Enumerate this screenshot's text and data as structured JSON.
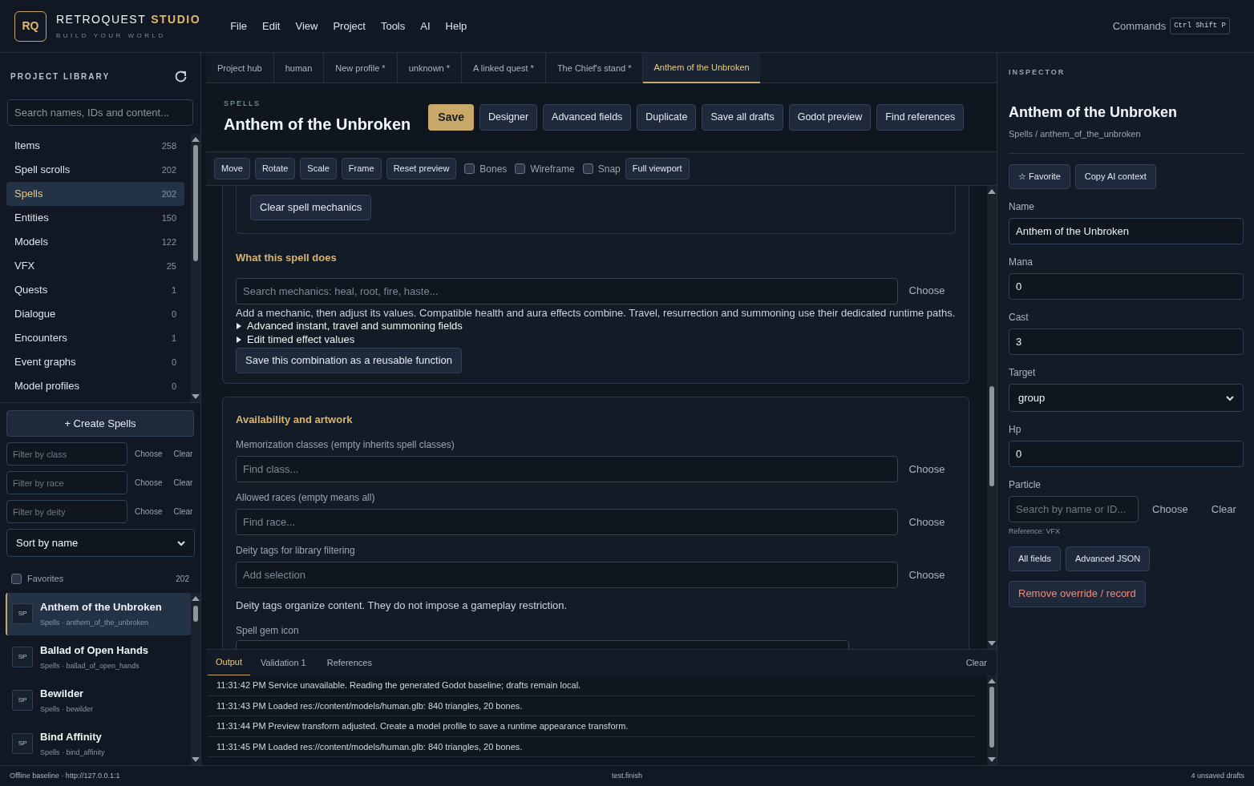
{
  "brand": {
    "logo": "RQ",
    "name": "RETROQUEST",
    "accent": "STUDIO",
    "tagline": "BUILD YOUR WORLD"
  },
  "menu": [
    "File",
    "Edit",
    "View",
    "Project",
    "Tools",
    "AI",
    "Help"
  ],
  "commands": {
    "label": "Commands",
    "shortcut": "Ctrl Shift P"
  },
  "library": {
    "title": "PROJECT LIBRARY",
    "search": {
      "placeholder": "Search names, IDs and content..."
    },
    "categories": [
      {
        "label": "Items",
        "count": "258",
        "selected": false
      },
      {
        "label": "Spell scrolls",
        "count": "202",
        "selected": false
      },
      {
        "label": "Spells",
        "count": "202",
        "selected": true
      },
      {
        "label": "Entities",
        "count": "150",
        "selected": false
      },
      {
        "label": "Models",
        "count": "122",
        "selected": false
      },
      {
        "label": "VFX",
        "count": "25",
        "selected": false
      },
      {
        "label": "Quests",
        "count": "1",
        "selected": false
      },
      {
        "label": "Dialogue",
        "count": "0",
        "selected": false
      },
      {
        "label": "Encounters",
        "count": "1",
        "selected": false
      },
      {
        "label": "Event graphs",
        "count": "0",
        "selected": false
      },
      {
        "label": "Model profiles",
        "count": "0",
        "selected": false
      }
    ],
    "create_button": "+ Create Spells",
    "filters": [
      {
        "placeholder": "Filter by class",
        "choose": "Choose",
        "clear": "Clear"
      },
      {
        "placeholder": "Filter by race",
        "choose": "Choose",
        "clear": "Clear"
      },
      {
        "placeholder": "Filter by deity",
        "choose": "Choose",
        "clear": "Clear"
      }
    ],
    "sort": "Sort by name",
    "favorites": {
      "label": "Favorites",
      "checked": false,
      "count": "202"
    },
    "records": [
      {
        "badge": "SP",
        "name": "Anthem of the Unbroken",
        "path": "Spells · anthem_of_the_unbroken",
        "selected": true
      },
      {
        "badge": "SP",
        "name": "Ballad of Open Hands",
        "path": "Spells · ballad_of_open_hands",
        "selected": false
      },
      {
        "badge": "SP",
        "name": "Bewilder",
        "path": "Spells · bewilder",
        "selected": false
      },
      {
        "badge": "SP",
        "name": "Bind Affinity",
        "path": "Spells · bind_affinity",
        "selected": false
      }
    ]
  },
  "tabs": [
    {
      "label": "Project hub",
      "selected": false
    },
    {
      "label": "human",
      "selected": false
    },
    {
      "label": "New profile *",
      "selected": false
    },
    {
      "label": "unknown *",
      "selected": false
    },
    {
      "label": "A linked quest *",
      "selected": false
    },
    {
      "label": "The Chief's stand *",
      "selected": false
    },
    {
      "label": "Anthem of the Unbroken",
      "selected": true
    }
  ],
  "editor": {
    "category": "SPELLS",
    "title": "Anthem of the Unbroken",
    "actions": [
      {
        "label": "Save",
        "kind": "primary"
      },
      {
        "label": "Designer",
        "kind": "default"
      },
      {
        "label": "Advanced fields",
        "kind": "default"
      },
      {
        "label": "Duplicate",
        "kind": "default"
      },
      {
        "label": "Save all drafts",
        "kind": "default"
      },
      {
        "label": "Godot preview",
        "kind": "default"
      },
      {
        "label": "Find references",
        "kind": "default"
      }
    ],
    "toolbar": [
      {
        "kind": "button",
        "label": "Move"
      },
      {
        "kind": "button",
        "label": "Rotate"
      },
      {
        "kind": "button",
        "label": "Scale"
      },
      {
        "kind": "button",
        "label": "Frame"
      },
      {
        "kind": "button",
        "label": "Reset preview"
      },
      {
        "kind": "checkbox",
        "label": "Bones",
        "checked": false
      },
      {
        "kind": "checkbox",
        "label": "Wireframe",
        "checked": false
      },
      {
        "kind": "checkbox",
        "label": "Snap",
        "checked": false
      },
      {
        "kind": "button",
        "label": "Full viewport"
      }
    ],
    "mechanics": {
      "clear_button": "Clear spell mechanics",
      "heading": "What this spell does",
      "search": {
        "placeholder": "Search mechanics: heal, root, fire, haste...",
        "choose": "Choose"
      },
      "help": "Add a mechanic, then adjust its values. Compatible health and aura effects combine. Travel, resurrection and summoning use their dedicated runtime paths.",
      "disclosures": [
        {
          "label": "Advanced instant, travel and summoning fields",
          "expanded": false
        },
        {
          "label": "Edit timed effect values",
          "expanded": false
        }
      ],
      "save_button": "Save this combination as a reusable function"
    },
    "availability": {
      "heading": "Availability and artwork",
      "fields": [
        {
          "label": "Memorization classes (empty inherits spell classes)",
          "placeholder": "Find class...",
          "choose": "Choose"
        },
        {
          "label": "Allowed races (empty means all)",
          "placeholder": "Find race...",
          "choose": "Choose"
        },
        {
          "label": "Deity tags for library filtering",
          "placeholder": "Add selection",
          "choose": "Choose"
        }
      ],
      "note": "Deity tags organize content. They do not impose a gameplay restriction.",
      "icon_label": "Spell gem icon"
    }
  },
  "output": {
    "tabs": [
      {
        "label": "Output",
        "selected": true
      },
      {
        "label": "Validation 1",
        "selected": false
      },
      {
        "label": "References",
        "selected": false
      }
    ],
    "clear": "Clear",
    "lines": [
      "11:31:42 PM Service unavailable. Reading the generated Godot baseline; drafts remain local.",
      "11:31:43 PM Loaded res://content/models/human.glb: 840 triangles, 20 bones.",
      "11:31:44 PM Preview transform adjusted. Create a model profile to save a runtime appearance transform.",
      "11:31:45 PM Loaded res://content/models/human.glb: 840 triangles, 20 bones."
    ]
  },
  "inspector": {
    "title": "INSPECTOR",
    "name": "Anthem of the Unbroken",
    "path": "Spells / anthem_of_the_unbroken",
    "buttons": [
      "☆ Favorite",
      "Copy AI context"
    ],
    "fields": [
      {
        "kind": "text",
        "label": "Name",
        "value": "Anthem of the Unbroken"
      },
      {
        "kind": "text",
        "label": "Mana",
        "value": "0"
      },
      {
        "kind": "text",
        "label": "Cast",
        "value": "3"
      },
      {
        "kind": "select",
        "label": "Target",
        "value": "group"
      },
      {
        "kind": "text",
        "label": "Hp",
        "value": "0"
      },
      {
        "kind": "reference",
        "label": "Particle",
        "placeholder": "Search by name or ID...",
        "choose": "Choose",
        "clear": "Clear",
        "note": "Reference: VFX"
      }
    ],
    "secondary_buttons": [
      "All fields",
      "Advanced JSON"
    ],
    "danger_button": "Remove override / record"
  },
  "status_bar": {
    "left": "Offline baseline · http://127.0.0.1:1",
    "center": "test.finish",
    "right": "4 unsaved drafts"
  }
}
